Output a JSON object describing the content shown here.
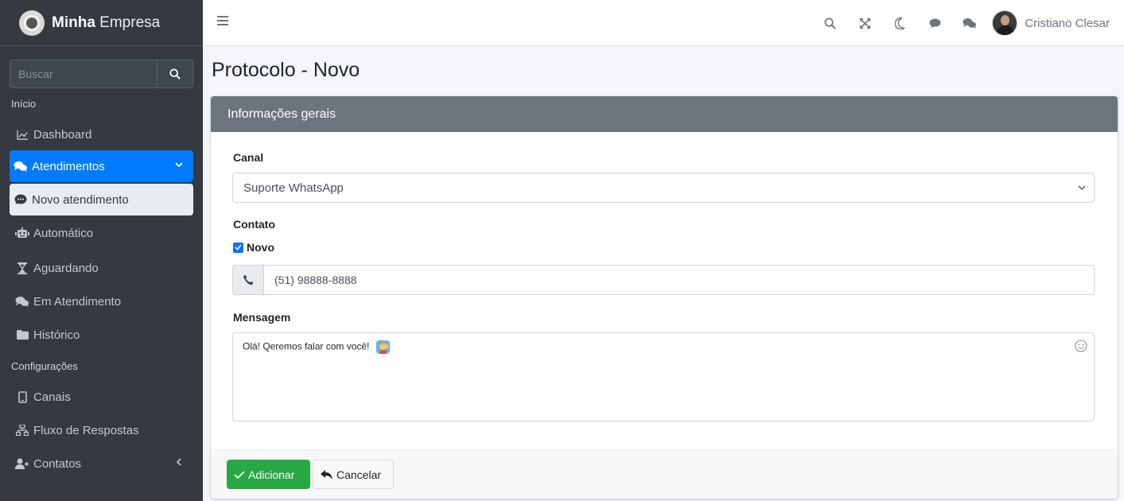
{
  "brand": {
    "name_bold": "Minha",
    "name_rest": " Empresa"
  },
  "sidebar": {
    "search_placeholder": "Buscar",
    "section_inicio": "Início",
    "section_config": "Configurações",
    "items": [
      {
        "label": "Dashboard",
        "icon": "chart-line-icon"
      },
      {
        "label": "Atendimentos",
        "icon": "comments-icon"
      },
      {
        "label": "Novo atendimento",
        "icon": "comment-dots-icon"
      },
      {
        "label": "Automático",
        "icon": "robot-icon"
      },
      {
        "label": "Aguardando",
        "icon": "hourglass-icon"
      },
      {
        "label": "Em Atendimento",
        "icon": "comments-icon"
      },
      {
        "label": "Histórico",
        "icon": "folder-icon"
      },
      {
        "label": "Canais",
        "icon": "mobile-icon"
      },
      {
        "label": "Fluxo de Respostas",
        "icon": "sitemap-icon"
      },
      {
        "label": "Contatos",
        "icon": "user-plus-icon"
      }
    ]
  },
  "topbar": {
    "user_name": "Cristiano Clesar"
  },
  "page": {
    "title": "Protocolo - Novo"
  },
  "card": {
    "header": "Informações gerais",
    "canal_label": "Canal",
    "canal_value": "Suporte WhatsApp",
    "contato_label": "Contato",
    "novo_label": "Novo",
    "phone_value": "(51) 98888-8888",
    "mensagem_label": "Mensagem",
    "mensagem_value": "Olá! Qeremos falar com você!"
  },
  "buttons": {
    "add": "Adicionar",
    "cancel": "Cancelar"
  },
  "colors": {
    "sidebar_bg": "#343a40",
    "active": "#007bff",
    "success": "#28a745",
    "card_header": "#6c757d"
  }
}
